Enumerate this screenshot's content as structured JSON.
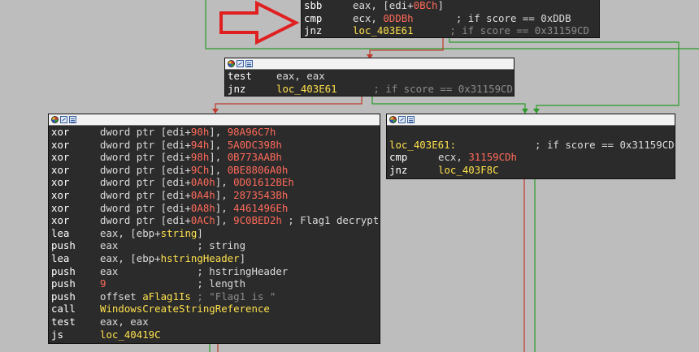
{
  "colors": {
    "background": "#bdbdbd",
    "node_bg": "#2b2b2b",
    "mnemonic": "#ffffff",
    "operand": "#dcdcdc",
    "immediate": "#ff6a5a",
    "symbol": "#ffe14d",
    "comment": "#8c8c8c",
    "edge_true": "#2a9a2a",
    "edge_false": "#c0392b",
    "annotation_arrow": "#e02020"
  },
  "icons": [
    "node-color-icon",
    "graph-view-icon",
    "list-view-icon"
  ],
  "blocks": {
    "top": {
      "lines": [
        {
          "mn": "sbb",
          "parts": [
            {
              "t": "eax, [edi+",
              "c": "op"
            },
            {
              "t": "0BCh",
              "c": "imm"
            },
            {
              "t": "]",
              "c": "op"
            }
          ]
        },
        {
          "mn": "cmp",
          "parts": [
            {
              "t": "ecx, ",
              "c": "op"
            },
            {
              "t": "0DDBh",
              "c": "imm"
            },
            {
              "t": "       ; if score == 0xDDB",
              "c": "op"
            }
          ]
        },
        {
          "mn": "jnz",
          "parts": [
            {
              "t": "loc_403E61",
              "c": "sym"
            },
            {
              "t": "      ; if score == 0x31159CD",
              "c": "cmt"
            }
          ]
        }
      ]
    },
    "test": {
      "lines": [
        {
          "mn": "test",
          "parts": [
            {
              "t": "eax, eax",
              "c": "op"
            }
          ]
        },
        {
          "mn": "jnz",
          "parts": [
            {
              "t": "loc_403E61",
              "c": "sym"
            },
            {
              "t": "      ; if score == 0x31159CD",
              "c": "cmt"
            }
          ]
        }
      ]
    },
    "decrypt": {
      "lines": [
        {
          "mn": "xor",
          "parts": [
            {
              "t": "dword ptr [edi+",
              "c": "op"
            },
            {
              "t": "90h",
              "c": "imm"
            },
            {
              "t": "], ",
              "c": "op"
            },
            {
              "t": "98A96C7h",
              "c": "imm"
            }
          ]
        },
        {
          "mn": "xor",
          "parts": [
            {
              "t": "dword ptr [edi+",
              "c": "op"
            },
            {
              "t": "94h",
              "c": "imm"
            },
            {
              "t": "], ",
              "c": "op"
            },
            {
              "t": "5A0DC398h",
              "c": "imm"
            }
          ]
        },
        {
          "mn": "xor",
          "parts": [
            {
              "t": "dword ptr [edi+",
              "c": "op"
            },
            {
              "t": "98h",
              "c": "imm"
            },
            {
              "t": "], ",
              "c": "op"
            },
            {
              "t": "0B773AABh",
              "c": "imm"
            }
          ]
        },
        {
          "mn": "xor",
          "parts": [
            {
              "t": "dword ptr [edi+",
              "c": "op"
            },
            {
              "t": "9Ch",
              "c": "imm"
            },
            {
              "t": "], ",
              "c": "op"
            },
            {
              "t": "0BE8806A0h",
              "c": "imm"
            }
          ]
        },
        {
          "mn": "xor",
          "parts": [
            {
              "t": "dword ptr [edi+",
              "c": "op"
            },
            {
              "t": "0A0h",
              "c": "imm"
            },
            {
              "t": "], ",
              "c": "op"
            },
            {
              "t": "0D01612BEh",
              "c": "imm"
            }
          ]
        },
        {
          "mn": "xor",
          "parts": [
            {
              "t": "dword ptr [edi+",
              "c": "op"
            },
            {
              "t": "0A4h",
              "c": "imm"
            },
            {
              "t": "], ",
              "c": "op"
            },
            {
              "t": "2873543Bh",
              "c": "imm"
            }
          ]
        },
        {
          "mn": "xor",
          "parts": [
            {
              "t": "dword ptr [edi+",
              "c": "op"
            },
            {
              "t": "0A8h",
              "c": "imm"
            },
            {
              "t": "], ",
              "c": "op"
            },
            {
              "t": "4461496Eh",
              "c": "imm"
            }
          ]
        },
        {
          "mn": "xor",
          "parts": [
            {
              "t": "dword ptr [edi+",
              "c": "op"
            },
            {
              "t": "0ACh",
              "c": "imm"
            },
            {
              "t": "], ",
              "c": "op"
            },
            {
              "t": "9C0BED2h",
              "c": "imm"
            },
            {
              "t": " ; Flag1 decrypt",
              "c": "op"
            }
          ]
        },
        {
          "mn": "lea",
          "parts": [
            {
              "t": "eax, [ebp+",
              "c": "op"
            },
            {
              "t": "string",
              "c": "sym"
            },
            {
              "t": "]",
              "c": "op"
            }
          ]
        },
        {
          "mn": "push",
          "parts": [
            {
              "t": "eax",
              "c": "op"
            },
            {
              "t": "             ; string",
              "c": "op"
            }
          ]
        },
        {
          "mn": "lea",
          "parts": [
            {
              "t": "eax, [ebp+",
              "c": "op"
            },
            {
              "t": "hstringHeader",
              "c": "sym"
            },
            {
              "t": "]",
              "c": "op"
            }
          ]
        },
        {
          "mn": "push",
          "parts": [
            {
              "t": "eax",
              "c": "op"
            },
            {
              "t": "             ; hstringHeader",
              "c": "op"
            }
          ]
        },
        {
          "mn": "push",
          "parts": [
            {
              "t": "9",
              "c": "imm"
            },
            {
              "t": "               ; length",
              "c": "op"
            }
          ]
        },
        {
          "mn": "push",
          "parts": [
            {
              "t": "offset ",
              "c": "op"
            },
            {
              "t": "aFlag1Is",
              "c": "sym"
            },
            {
              "t": " ; \"Flag1 is \"",
              "c": "cmt"
            }
          ]
        },
        {
          "mn": "call",
          "parts": [
            {
              "t": "WindowsCreateStringReference",
              "c": "sym"
            }
          ]
        },
        {
          "mn": "test",
          "parts": [
            {
              "t": "eax, eax",
              "c": "op"
            }
          ]
        },
        {
          "mn": "js",
          "parts": [
            {
              "t": "loc_40419C",
              "c": "sym"
            }
          ]
        }
      ]
    },
    "target": {
      "lines": [
        {
          "mn": "",
          "parts": []
        },
        {
          "mn": "",
          "parts": [
            {
              "t": "loc_403E61:",
              "c": "lbl"
            },
            {
              "t": "             ; if score == 0x31159CD",
              "c": "op"
            }
          ]
        },
        {
          "mn": "cmp",
          "parts": [
            {
              "t": "ecx, ",
              "c": "op"
            },
            {
              "t": "31159CDh",
              "c": "imm"
            }
          ]
        },
        {
          "mn": "jnz",
          "parts": [
            {
              "t": "loc_403F8C",
              "c": "sym"
            }
          ]
        }
      ]
    }
  }
}
